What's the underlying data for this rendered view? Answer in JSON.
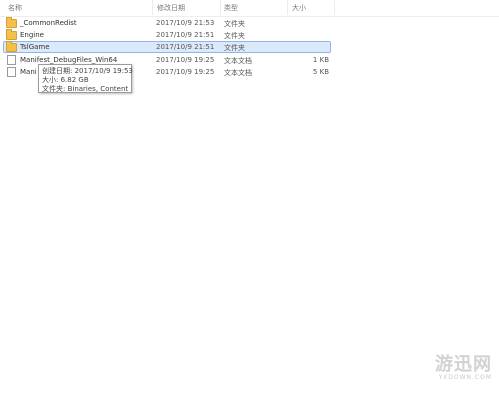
{
  "columns": {
    "name": "名称",
    "date": "修改日期",
    "type": "类型",
    "size": "大小"
  },
  "files": [
    {
      "name": "_CommonRedist",
      "date": "2017/10/9 21:53",
      "type": "文件夹",
      "size": "",
      "icon": "folder-icon"
    },
    {
      "name": "Engine",
      "date": "2017/10/9 21:51",
      "type": "文件夹",
      "size": "",
      "icon": "folder-icon"
    },
    {
      "name": "TslGame",
      "date": "2017/10/9 21:51",
      "type": "文件夹",
      "size": "",
      "icon": "folder-icon",
      "selected": true
    },
    {
      "name": "Manifest_DebugFiles_Win64",
      "date": "2017/10/9 19:25",
      "type": "文本文档",
      "size": "1 KB",
      "icon": "document-icon"
    },
    {
      "name": "Mani",
      "date": "2017/10/9 19:25",
      "type": "文本文档",
      "size": "5 KB",
      "icon": "document-icon"
    }
  ],
  "tooltip": {
    "created": "创建日期: 2017/10/9 19:53",
    "size": "大小: 6.82 GB",
    "folders": "文件夹: Binaries, Content"
  },
  "watermark": {
    "main": "游迅网",
    "sub": "YXDOWN.COM"
  }
}
